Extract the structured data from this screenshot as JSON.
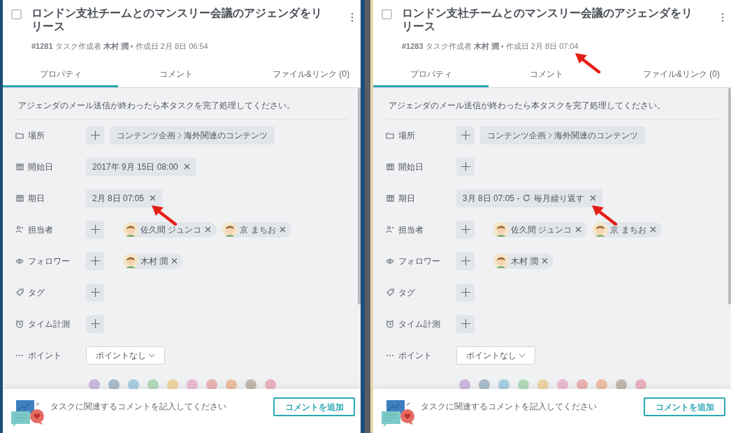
{
  "panels": [
    {
      "task": {
        "checked": false,
        "title": "ロンドン支社チームとのマンスリー会議のアジェンダをリリース",
        "meta": "**#1281** タスク作成者 **木村 潤** • 作成日 2月 8日 06:54",
        "meta_annotated": false
      },
      "tabs": [
        {
          "label": "プロパティ",
          "selected": true
        },
        {
          "label": "コメント",
          "selected": false
        },
        {
          "label": "ファイル&リンク (0)",
          "selected": false
        }
      ],
      "description": "アジェンダのメール送信が終わったら本タスクを完了処理してください。",
      "properties": [
        {
          "kind": "location",
          "label": "場所",
          "add_button": true,
          "path": [
            "コンテンツ企画",
            "海外関連のコンテンツ"
          ]
        },
        {
          "kind": "start",
          "label": "開始日",
          "add_button": false,
          "date": {
            "text": "2017年 9月 15日 08:00",
            "annotated": false
          }
        },
        {
          "kind": "due",
          "label": "期日",
          "add_button": false,
          "date": {
            "text": "2月 8日 07:05",
            "annotated": true
          }
        },
        {
          "kind": "assignee",
          "label": "担当者",
          "add_button": true,
          "people": [
            "佐久間 ジュンコ",
            "京 まちお"
          ]
        },
        {
          "kind": "follower",
          "label": "フォロワー",
          "add_button": true,
          "people": [
            "木村 潤"
          ]
        },
        {
          "kind": "tag",
          "label": "タグ",
          "add_button": true
        },
        {
          "kind": "timer",
          "label": "タイム計測",
          "add_button": true
        },
        {
          "kind": "points",
          "label": "ポイント",
          "select": "ポイントなし"
        }
      ],
      "color_options": [
        {
          "color": "#cbb8de"
        },
        {
          "color": "#a9bccb"
        },
        {
          "color": "#a9cde2"
        },
        {
          "color": "#b3d9bb"
        },
        {
          "color": "#eed4a2"
        },
        {
          "color": "#ebb9d1"
        },
        {
          "color": "#e9b2b2"
        },
        {
          "color": "#edbea2"
        },
        {
          "color": "#c2b7aa"
        },
        {
          "color": "#e9b3be"
        }
      ],
      "comment_bar": {
        "prompt": "タスクに関連するコメントを記入してください",
        "button": "コメントを追加"
      }
    },
    {
      "task": {
        "checked": false,
        "title": "ロンドン支社チームとのマンスリー会議のアジェンダをリリース",
        "meta": "**#1283** タスク作成者 **木村 潤** • 作成日 2月 8日 07:04",
        "meta_annotated": true
      },
      "tabs": [
        {
          "label": "プロパティ",
          "selected": true
        },
        {
          "label": "コメント",
          "selected": false
        },
        {
          "label": "ファイル&リンク (0)",
          "selected": false
        }
      ],
      "description": "アジェンダのメール送信が終わったら本タスクを完了処理してください。",
      "properties": [
        {
          "kind": "location",
          "label": "場所",
          "add_button": true,
          "path": [
            "コンテンツ企画",
            "海外関連のコンテンツ"
          ]
        },
        {
          "kind": "start",
          "label": "開始日",
          "add_button": true
        },
        {
          "kind": "due",
          "label": "期日",
          "add_button": false,
          "date": {
            "text": "3月 8日 07:05 -",
            "repeat": "毎月繰り返す",
            "annotated": true
          }
        },
        {
          "kind": "assignee",
          "label": "担当者",
          "add_button": true,
          "people": [
            "佐久間 ジュンコ",
            "京 まちお"
          ]
        },
        {
          "kind": "follower",
          "label": "フォロワー",
          "add_button": true,
          "people": [
            "木村 潤"
          ]
        },
        {
          "kind": "tag",
          "label": "タグ",
          "add_button": true
        },
        {
          "kind": "timer",
          "label": "タイム計測",
          "add_button": true
        },
        {
          "kind": "points",
          "label": "ポイント",
          "select": "ポイントなし"
        }
      ],
      "color_options": [
        {
          "color": "#cbb8de"
        },
        {
          "color": "#a9bccb"
        },
        {
          "color": "#a9cde2"
        },
        {
          "color": "#b3d9bb"
        },
        {
          "color": "#eed4a2"
        },
        {
          "color": "#ebb9d1"
        },
        {
          "color": "#e9b2b2"
        },
        {
          "color": "#edbea2"
        },
        {
          "color": "#c2b7aa"
        },
        {
          "color": "#e9b3be"
        }
      ],
      "comment_bar": {
        "prompt": "タスクに関連するコメントを記入してください",
        "button": "コメントを追加"
      }
    }
  ]
}
